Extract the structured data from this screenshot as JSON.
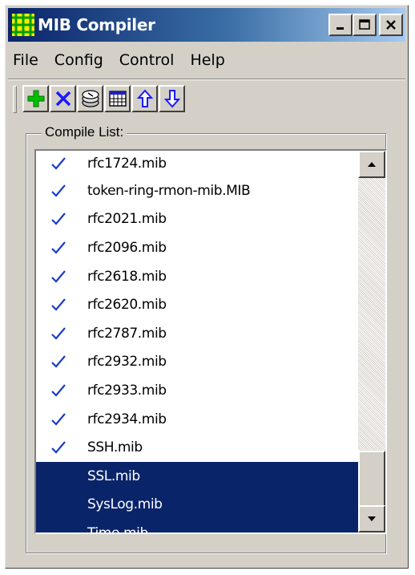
{
  "window": {
    "title": "MIB Compiler",
    "controls": [
      "minimize",
      "maximize",
      "close"
    ]
  },
  "menu": [
    "File",
    "Config",
    "Control",
    "Help"
  ],
  "toolbar": [
    {
      "name": "add-button",
      "icon": "plus-icon",
      "color": "#00c000"
    },
    {
      "name": "remove-button",
      "icon": "x-icon",
      "color": "#0000ff"
    },
    {
      "name": "compile-button",
      "icon": "stack-icon"
    },
    {
      "name": "grid-button",
      "icon": "calendar-icon"
    },
    {
      "name": "move-up-button",
      "icon": "arrow-up-icon",
      "color": "#0000ff"
    },
    {
      "name": "move-down-button",
      "icon": "arrow-down-icon",
      "color": "#0000ff"
    }
  ],
  "compile_list": {
    "label": "Compile List:",
    "items": [
      {
        "label": "rfc1724.mib",
        "checked": true,
        "selected": false
      },
      {
        "label": "token-ring-rmon-mib.MIB",
        "checked": true,
        "selected": false
      },
      {
        "label": "rfc2021.mib",
        "checked": true,
        "selected": false
      },
      {
        "label": "rfc2096.mib",
        "checked": true,
        "selected": false
      },
      {
        "label": "rfc2618.mib",
        "checked": true,
        "selected": false
      },
      {
        "label": "rfc2620.mib",
        "checked": true,
        "selected": false
      },
      {
        "label": "rfc2787.mib",
        "checked": true,
        "selected": false
      },
      {
        "label": "rfc2932.mib",
        "checked": true,
        "selected": false
      },
      {
        "label": "rfc2933.mib",
        "checked": true,
        "selected": false
      },
      {
        "label": "rfc2934.mib",
        "checked": true,
        "selected": false
      },
      {
        "label": "SSH.mib",
        "checked": true,
        "selected": false
      },
      {
        "label": "SSL.mib",
        "checked": false,
        "selected": true
      },
      {
        "label": "SysLog.mib",
        "checked": false,
        "selected": true
      },
      {
        "label": "Time.mib",
        "checked": false,
        "selected": true
      }
    ]
  },
  "colors": {
    "selection": "#0a246a",
    "check": "#1a3cc8",
    "face": "#d4d0c8"
  }
}
